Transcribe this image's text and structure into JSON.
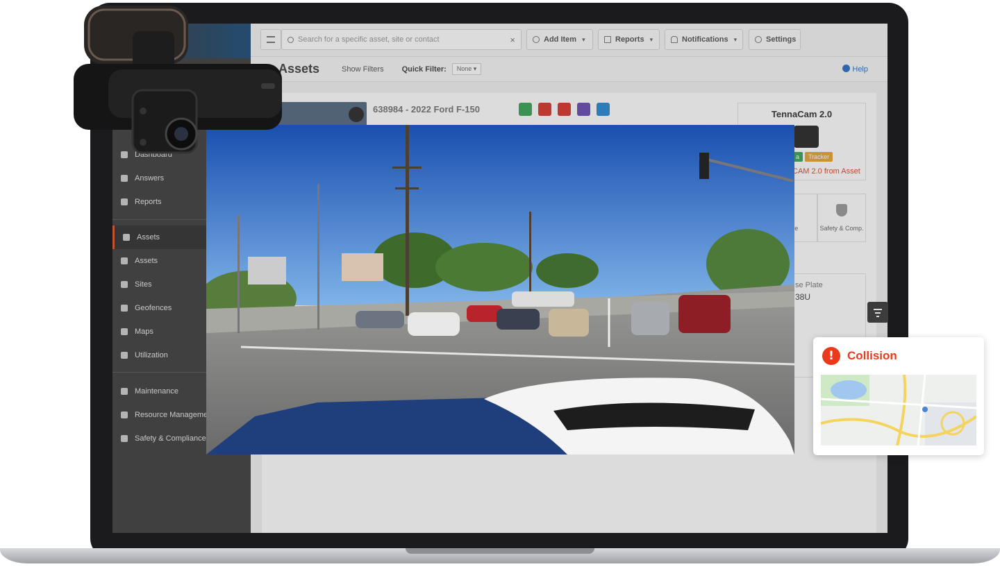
{
  "topbar": {
    "search_placeholder": "Search for a specific asset, site or contact",
    "add_item": "Add Item",
    "reports": "Reports",
    "notifications": "Notifications",
    "settings": "Settings"
  },
  "subheader": {
    "title": "Assets",
    "show_filters": "Show Filters",
    "quick_filter_label": "Quick Filter:",
    "quick_filter_value": "None",
    "help": "Help"
  },
  "sidebar": {
    "items": [
      {
        "label": "Dashboard"
      },
      {
        "label": "Answers"
      },
      {
        "label": "Reports"
      },
      {
        "label": "Assets"
      },
      {
        "label": "Assets"
      },
      {
        "label": "Sites"
      },
      {
        "label": "Geofences"
      },
      {
        "label": "Maps"
      },
      {
        "label": "Utilization"
      },
      {
        "label": "Maintenance"
      },
      {
        "label": "Resource Management"
      },
      {
        "label": "Safety & Compliance"
      }
    ]
  },
  "asset": {
    "name": "638984 - 2022 Ford F-150",
    "badge_colors": [
      "#3aa657",
      "#d8372f",
      "#d8372f",
      "#6a4fb5",
      "#2a8ad6"
    ]
  },
  "camera_card": {
    "title": "TennaCam 2.0",
    "tag_a": "a",
    "tag_tracker": "Tracker",
    "remove_link": "CAM 2.0 from Asset"
  },
  "tiles": {
    "left": "nce",
    "right": "Safety & Comp."
  },
  "plate": {
    "label": "se Plate",
    "value": "38U"
  },
  "collision": {
    "title": "Collision",
    "icon": "!"
  },
  "colors": {
    "accent": "#e0592a",
    "alert": "#ea3a1b",
    "link": "#2a73c9"
  }
}
